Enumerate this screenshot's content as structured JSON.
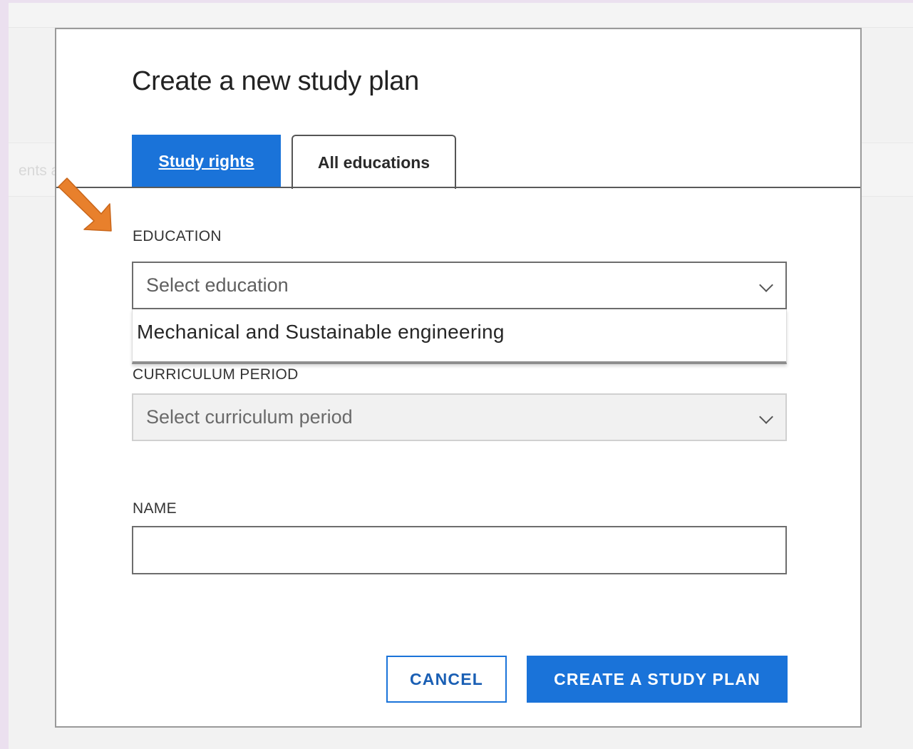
{
  "background": {
    "fragment_text": "ents a"
  },
  "modal": {
    "title": "Create a new study plan",
    "tabs": [
      {
        "label": "Study rights",
        "active": true
      },
      {
        "label": "All educations",
        "active": false
      }
    ],
    "education": {
      "label": "EDUCATION",
      "placeholder": "Select education",
      "options": [
        "Mechanical and Sustainable engineering"
      ]
    },
    "curriculum_period": {
      "label": "CURRICULUM PERIOD",
      "placeholder": "Select curriculum period",
      "disabled": true
    },
    "name": {
      "label": "NAME",
      "value": ""
    },
    "buttons": {
      "cancel": "CANCEL",
      "create": "CREATE A STUDY PLAN"
    }
  },
  "colors": {
    "accent": "#1a73d9",
    "annotation_arrow": "#e8802c",
    "page_border": "#ebe0ef"
  },
  "icons": {
    "select_chevron": "chevron-down-icon",
    "annotation": "arrow-icon"
  }
}
